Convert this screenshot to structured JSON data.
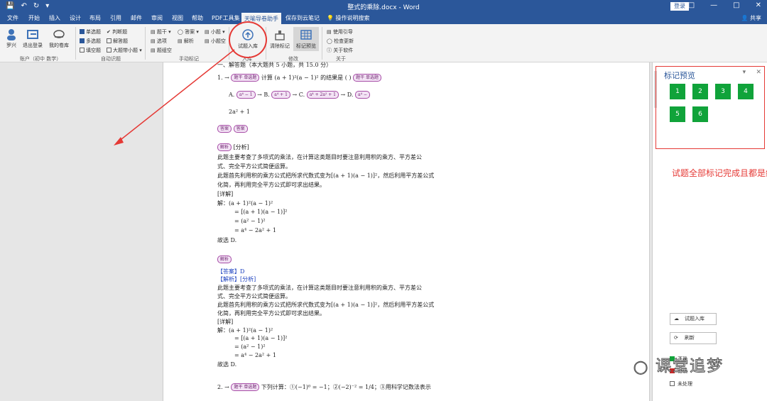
{
  "titlebar": {
    "doc_title": "整式的乘除.docx - Word",
    "login": "登录",
    "share": "共享"
  },
  "tabs": [
    "文件",
    "开始",
    "插入",
    "设计",
    "布局",
    "引用",
    "邮件",
    "审阅",
    "视图",
    "帮助",
    "PDF工具集",
    "天喻导卷助手",
    "保存到云笔记",
    "操作说明搜索"
  ],
  "ribbon": {
    "user": "罗兴",
    "logout": "退出登录",
    "mylib": "我的卷库",
    "account_group": "账户（初中 数学）",
    "auto": {
      "single": "单选题",
      "judge": "判断题",
      "multi": "多选题",
      "answer": "解答题",
      "fill": "填空题",
      "big": "大题带小题",
      "label": "自动识题"
    },
    "manual": {
      "stem": "题干",
      "answer": "答案",
      "sub": "小题",
      "option": "选项",
      "analysis": "解析",
      "subfill": "小题空",
      "fillgroup": "题组空",
      "label": "手动标记"
    },
    "import": {
      "btn": "试题入库",
      "label": "入库"
    },
    "modify": {
      "clear": "清除标记",
      "preview": "标记预览",
      "label": "修改"
    },
    "about": {
      "guide": "使用引导",
      "update": "检查更新",
      "software": "关于软件",
      "label": "关于"
    }
  },
  "doc": {
    "section": "一、解答题（本大题共 5 小题，共 15.0 分）",
    "q1_prefix": "1. →",
    "q1_tag": "题干 单选题",
    "q1_text": "计算 (a + 1)²(a − 1)² 的结果是 (    )",
    "q1_tag2": "题干 单选题",
    "optA": "A.",
    "optA_val": "a⁴ − 1",
    "optB": "B.",
    "optB_val": "a⁴ + 1",
    "optC": "C.",
    "optC_val": "a⁴ + 2a² + 1",
    "optD": "D.",
    "optD_val": "a⁴ −",
    "optD_cont": "2a² + 1",
    "ans_tag1": "答案",
    "ans_tag2": "答案",
    "ana_tag": "解析",
    "fenxi": "[分析]",
    "l1": "此题主要考查了多项式的乘法，在计算这类题目时要注意利用积的乘方、平方差公",
    "l2": "式、完全平方公式简便运算。",
    "l3": "此题首先利用积的乘方公式把所求代数式变为[(a + 1)(a − 1)]²，然后利用平方差公式",
    "l4": "化简，再利用完全平方公式即可求出结果。",
    "detail": "[详解]",
    "s1": "解：(a + 1)²(a − 1)²",
    "s2": "= [(a + 1)(a − 1)]²",
    "s3": "= (a² − 1)²",
    "s4": "= a⁴ − 2a² + 1",
    "conclude": "故选 D.",
    "ana_tag2": "解析",
    "answer_line": "【答案】D",
    "jiexi_line": "【解析】[分析]",
    "q2_prefix": "2. →",
    "q2_tag": "题干 单选题",
    "q2_text": "下列计算：①(−1)⁰ = −1；②(−2)⁻² = 1/4；③用科学记数法表示"
  },
  "pane": {
    "title": "标记预览",
    "marks": [
      "1",
      "2",
      "3",
      "4",
      "5",
      "6"
    ],
    "import_btn": "试题入库",
    "refresh_btn": "刷新",
    "legend_ok": "正确",
    "legend_err": "错误",
    "legend_none": "未处理"
  },
  "annotation": "试题全部标记完成且都是绿色",
  "watermark": "课堂追梦",
  "colors": {
    "accent": "#2b579a",
    "mark_green": "#10a33a",
    "annotation_red": "#e53935"
  }
}
